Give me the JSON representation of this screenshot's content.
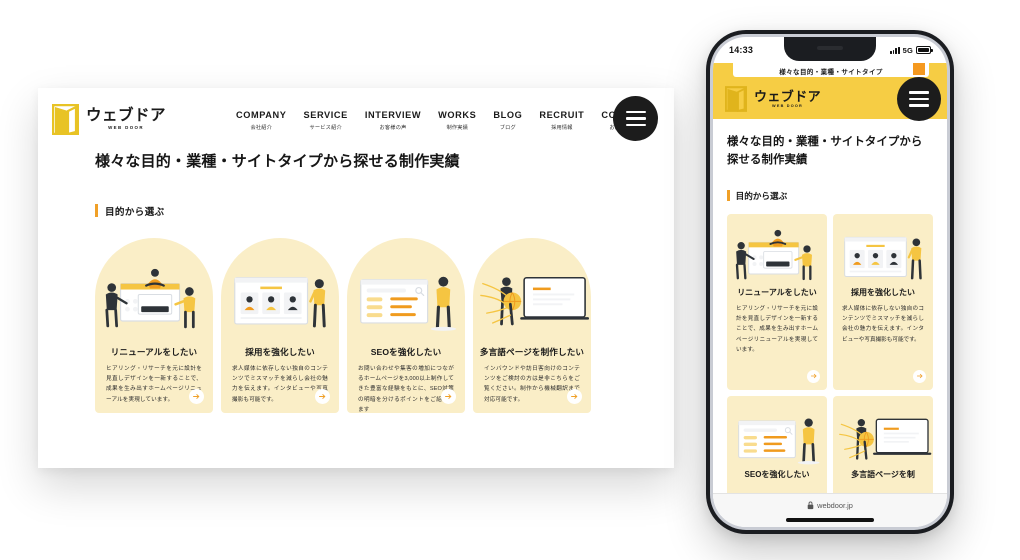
{
  "brand": {
    "logo_jp": "ウェブドア",
    "logo_en": "WEB DOOR",
    "accent_yellow": "#f6cd44",
    "card_bg": "#faeec7",
    "accent_orange": "#f0a028",
    "dark": "#1c1c1c"
  },
  "desktop": {
    "nav": [
      {
        "en": "COMPANY",
        "jp": "会社紹介"
      },
      {
        "en": "SERVICE",
        "jp": "サービス紹介"
      },
      {
        "en": "INTERVIEW",
        "jp": "お客様の声"
      },
      {
        "en": "WORKS",
        "jp": "制作実績"
      },
      {
        "en": "BLOG",
        "jp": "ブログ"
      },
      {
        "en": "RECRUIT",
        "jp": "採用情報"
      },
      {
        "en": "CONTACT",
        "jp": "お問い合わせ"
      }
    ],
    "menu_button": "hamburger-menu",
    "page_title": "様々な目的・業種・サイトタイプから探せる制作実績",
    "section_label": "目的から選ぶ",
    "cards": [
      {
        "title": "リニューアルをしたい",
        "text": "ヒアリング・リサーチを元に設計を見直しデザインを一新することで、成果を生み出すホームページリニューアルを実現しています。",
        "art": "renewal-illustration",
        "arrow": "arrow-right-icon"
      },
      {
        "title": "採用を強化したい",
        "text": "求人媒体に依存しない独自のコンテンツでミスマッチを減らし会社の魅力を伝えます。インタビューや写真撮影も可能です。",
        "art": "recruit-illustration",
        "arrow": "arrow-right-icon"
      },
      {
        "title": "SEOを強化したい",
        "text": "お問い合わせや集客の増加につながるホームページを3,000以上制作してきた豊富な経験をもとに、SEO対策の明暗を分けるポイントをご紹介します",
        "art": "seo-illustration",
        "arrow": "arrow-right-icon"
      },
      {
        "title": "多言語ページを制作したい",
        "text": "インバウンドや訪日客向けのコンテンツをご検討の方は是非こちらをご覧ください。制作から機械翻訳まで対応可能です。",
        "art": "multilingual-illustration",
        "arrow": "arrow-right-icon"
      }
    ]
  },
  "phone": {
    "status": {
      "time": "14:33",
      "network": "5G",
      "signal": "cellular-signal-icon",
      "battery": "battery-icon"
    },
    "peek_text": "様々な目的・業種・サイトタイプ",
    "page_title": "様々な目的・業種・サイトタイプから探せる制作実績",
    "section_label": "目的から選ぶ",
    "cards": [
      {
        "title": "リニューアルをしたい",
        "text": "ヒアリング・リサーチを元に設計を見直しデザインを一新することで、成果を生み出すホームページリニューアルを実現しています。",
        "art": "renewal-illustration",
        "arrow": "arrow-right-icon"
      },
      {
        "title": "採用を強化したい",
        "text": "求人媒体に依存しない独自のコンテンツでミスマッチを減らし会社の魅力を伝えます。インタビューや写真撮影も可能です。",
        "art": "recruit-illustration",
        "arrow": "arrow-right-icon"
      },
      {
        "title": "SEOを強化したい",
        "text": "",
        "art": "seo-illustration",
        "arrow": "arrow-right-icon"
      },
      {
        "title": "多言語ページを制",
        "text": "",
        "art": "multilingual-illustration",
        "arrow": "arrow-right-icon"
      }
    ],
    "url": "webdoor.jp",
    "lock": "lock-icon"
  }
}
